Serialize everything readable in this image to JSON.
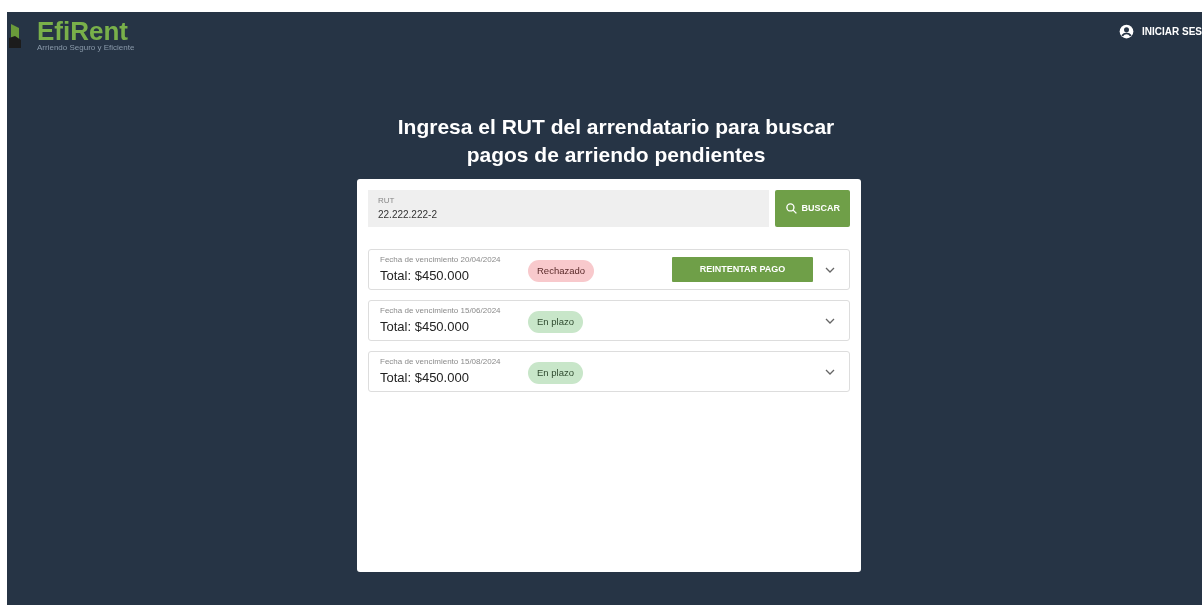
{
  "header": {
    "logo": "EfiRent",
    "tagline": "Arriendo Seguro y Eficiente",
    "login": "INICIAR SES"
  },
  "heading": "Ingresa el RUT del arrendatario para buscar pagos de arriendo pendientes",
  "search": {
    "label": "RUT",
    "value": "22.222.222-2",
    "button": "BUSCAR"
  },
  "payments": [
    {
      "due": "Fecha de vencimiento 20/04/2024",
      "total": "Total: $450.000",
      "status": "Rechazado",
      "kind": "rejected",
      "action": "REINTENTAR PAGO"
    },
    {
      "due": "Fecha de vencimiento 15/06/2024",
      "total": "Total: $450.000",
      "status": "En plazo",
      "kind": "on_time"
    },
    {
      "due": "Fecha de vencimiento 15/08/2024",
      "total": "Total: $450.000",
      "status": "En plazo",
      "kind": "on_time"
    }
  ]
}
